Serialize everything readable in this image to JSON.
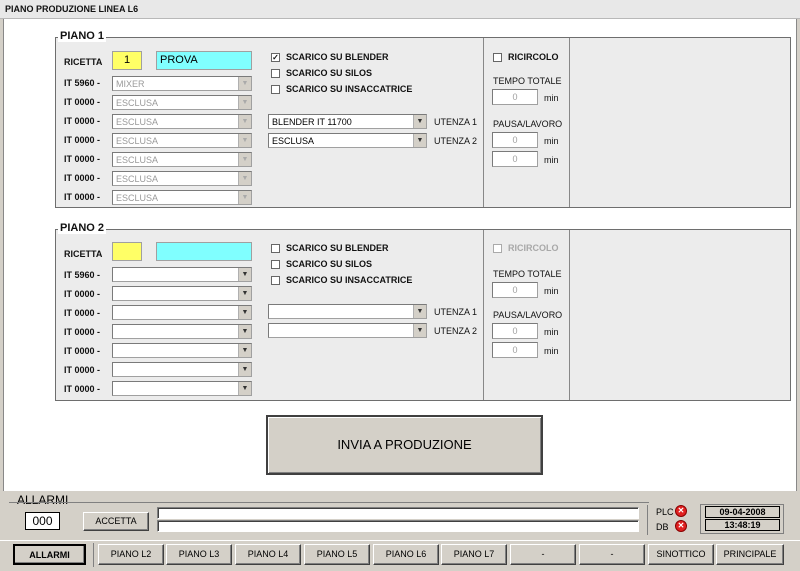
{
  "window": {
    "title": "PIANO PRODUZIONE LINEA L6"
  },
  "piano1": {
    "title": "PIANO 1",
    "ricetta_label": "RICETTA",
    "ricetta_num": "1",
    "ricetta_name": "PROVA",
    "rows": [
      {
        "label": "IT 5960 -",
        "value": "MIXER"
      },
      {
        "label": "IT 0000 -",
        "value": "ESCLUSA"
      },
      {
        "label": "IT 0000 -",
        "value": "ESCLUSA"
      },
      {
        "label": "IT 0000 -",
        "value": "ESCLUSA"
      },
      {
        "label": "IT 0000 -",
        "value": "ESCLUSA"
      },
      {
        "label": "IT 0000 -",
        "value": "ESCLUSA"
      },
      {
        "label": "IT 0000 -",
        "value": "ESCLUSA"
      }
    ],
    "scarico_blender": "SCARICO SU BLENDER",
    "scarico_silos": "SCARICO SU SILOS",
    "scarico_insacc": "SCARICO SU INSACCATRICE",
    "utenza1_value": "BLENDER IT 11700",
    "utenza1_label": "UTENZA 1",
    "utenza2_value": "ESCLUSA",
    "utenza2_label": "UTENZA 2",
    "ricircolo": "RICIRCOLO",
    "tempo_totale": "TEMPO TOTALE",
    "tempo_value": "0",
    "pausa_lavoro": "PAUSA/LAVORO",
    "pausa_value": "0",
    "lavoro_value": "0",
    "min": "min"
  },
  "piano2": {
    "title": "PIANO 2",
    "ricetta_label": "RICETTA",
    "ricetta_num": "",
    "ricetta_name": "",
    "rows": [
      {
        "label": "IT 5960 -",
        "value": ""
      },
      {
        "label": "IT 0000 -",
        "value": ""
      },
      {
        "label": "IT 0000 -",
        "value": ""
      },
      {
        "label": "IT 0000 -",
        "value": ""
      },
      {
        "label": "IT 0000 -",
        "value": ""
      },
      {
        "label": "IT 0000 -",
        "value": ""
      },
      {
        "label": "IT 0000 -",
        "value": ""
      }
    ],
    "scarico_blender": "SCARICO SU BLENDER",
    "scarico_silos": "SCARICO SU SILOS",
    "scarico_insacc": "SCARICO SU INSACCATRICE",
    "utenza1_value": "",
    "utenza1_label": "UTENZA 1",
    "utenza2_value": "",
    "utenza2_label": "UTENZA 2",
    "ricircolo": "RICIRCOLO",
    "tempo_totale": "TEMPO TOTALE",
    "tempo_value": "0",
    "pausa_lavoro": "PAUSA/LAVORO",
    "pausa_value": "0",
    "lavoro_value": "0",
    "min": "min"
  },
  "invia_button": "INVIA A PRODUZIONE",
  "allarmi": {
    "title": "ALLARMI",
    "count": "000",
    "accetta": "ACCETTA",
    "plc": "PLC",
    "db": "DB",
    "date": "09-04-2008",
    "time": "13:48:19"
  },
  "footer": {
    "buttons": [
      "ALLARMI",
      "PIANO L2",
      "PIANO L3",
      "PIANO L4",
      "PIANO L5",
      "PIANO L6",
      "PIANO L7",
      "-",
      "-",
      "SINOTTICO",
      "PRINCIPALE"
    ]
  }
}
